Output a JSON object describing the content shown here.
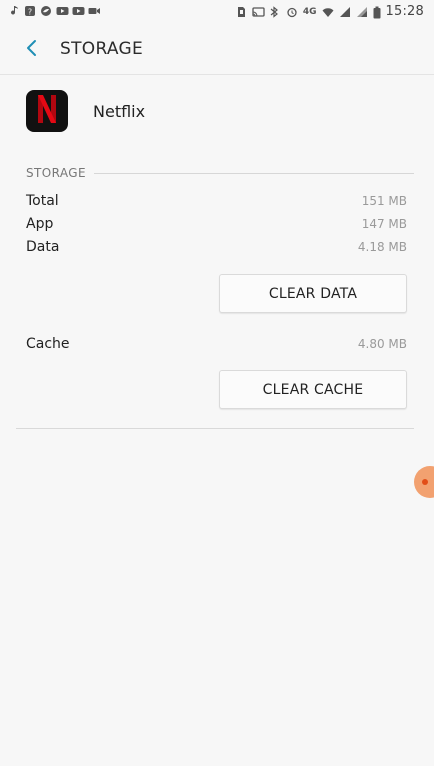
{
  "status_bar": {
    "left_icons": [
      "music-note-icon",
      "question-box-icon",
      "chat-leaf-icon",
      "youtube-icon",
      "youtube-icon",
      "video-icon"
    ],
    "right_icons": [
      "sd-card-icon",
      "cast-icon",
      "bluetooth-icon",
      "alarm-icon",
      "wifi-icon",
      "signal-icon",
      "signal-icon",
      "battery-icon"
    ],
    "network_label": "4G",
    "time": "15:28"
  },
  "app_bar": {
    "title": "STORAGE",
    "back_icon": "back-arrow-icon"
  },
  "app": {
    "name": "Netflix",
    "icon_letter": "N",
    "brand_color": "#e50914"
  },
  "storage": {
    "header": "STORAGE",
    "rows": [
      {
        "label": "Total",
        "value": "151 MB"
      },
      {
        "label": "App",
        "value": "147 MB"
      },
      {
        "label": "Data",
        "value": "4.18 MB"
      }
    ],
    "clear_data_label": "CLEAR DATA",
    "cache_label": "Cache",
    "cache_value": "4.80 MB",
    "clear_cache_label": "CLEAR CACHE"
  },
  "colors": {
    "accent": "#1f8fb5",
    "handle": "#f2a170"
  }
}
